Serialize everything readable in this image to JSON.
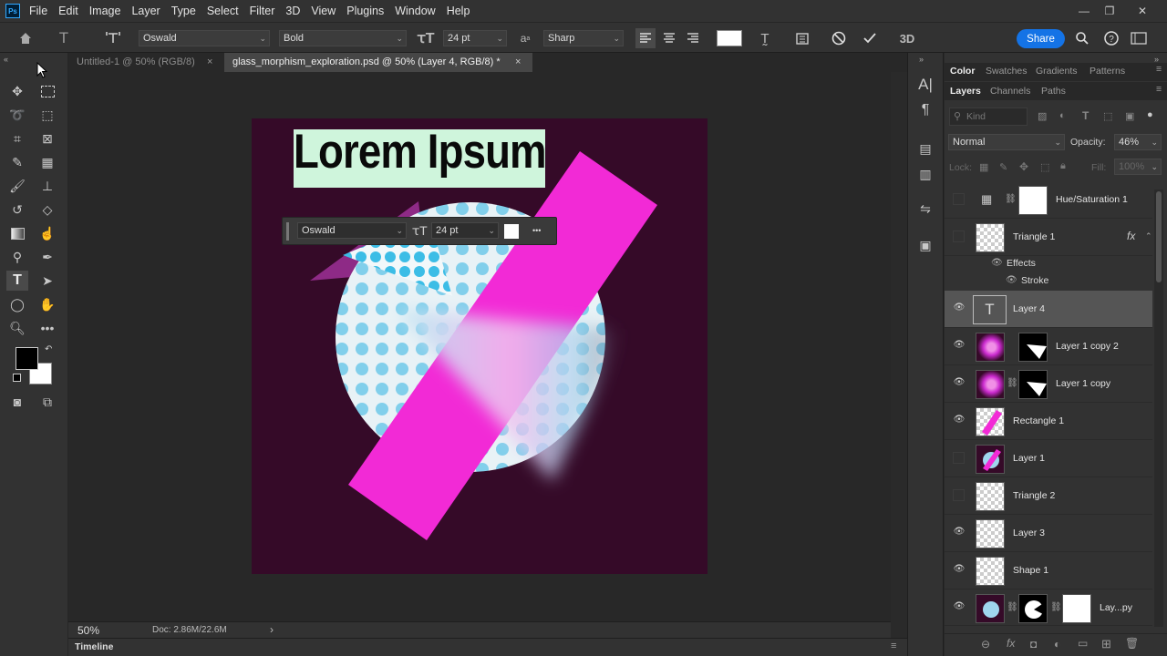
{
  "menubar": {
    "logo": "Ps",
    "items": [
      "File",
      "Edit",
      "Image",
      "Layer",
      "Type",
      "Select",
      "Filter",
      "3D",
      "View",
      "Plugins",
      "Window",
      "Help"
    ]
  },
  "options": {
    "font_family": "Oswald",
    "font_style": "Bold",
    "font_size": "24 pt",
    "aa_label": "a",
    "antialias": "Sharp",
    "share": "Share",
    "threed": "3D"
  },
  "tabs": [
    {
      "label": "Untitled-1 @ 50% (RGB/8)",
      "close": "×"
    },
    {
      "label": "glass_morphism_exploration.psd @ 50% (Layer 4, RGB/8) *",
      "close": "×"
    }
  ],
  "canvas": {
    "headline": "Lorem Ipsum",
    "float_font": "Oswald",
    "float_size": "24 pt",
    "more": "•••"
  },
  "status": {
    "zoom": "50%",
    "doc": "Doc: 2.86M/22.6M",
    "arrow": "›"
  },
  "timeline": {
    "label": "Timeline"
  },
  "panels": {
    "top_tabs": [
      "Color",
      "Swatches",
      "Gradients",
      "Patterns"
    ],
    "layer_tabs": [
      "Layers",
      "Channels",
      "Paths"
    ],
    "search_placeholder": "Kind",
    "blend_mode": "Normal",
    "opacity_label": "Opacity:",
    "opacity_value": "46%",
    "lock_label": "Lock:",
    "fill_label": "Fill:",
    "fill_value": "100%",
    "effects_label": "Effects",
    "stroke_label": "Stroke",
    "fx": "fx"
  },
  "layers": [
    {
      "name": "Hue/Saturation 1",
      "visible": false
    },
    {
      "name": "Triangle 1",
      "visible": false
    },
    {
      "name": "Layer 4",
      "visible": true
    },
    {
      "name": "Layer 1 copy 2",
      "visible": true
    },
    {
      "name": "Layer 1 copy",
      "visible": true
    },
    {
      "name": "Rectangle 1",
      "visible": true
    },
    {
      "name": "Layer 1",
      "visible": false
    },
    {
      "name": "Triangle 2",
      "visible": false
    },
    {
      "name": "Layer 3",
      "visible": true
    },
    {
      "name": "Shape 1",
      "visible": true
    },
    {
      "name": "Lay...py",
      "visible": true
    }
  ],
  "colors": {
    "accent": "#1473e6",
    "doc_bg": "#350a28",
    "magenta": "#f22ad6",
    "text_bg": "#cff5dc"
  }
}
